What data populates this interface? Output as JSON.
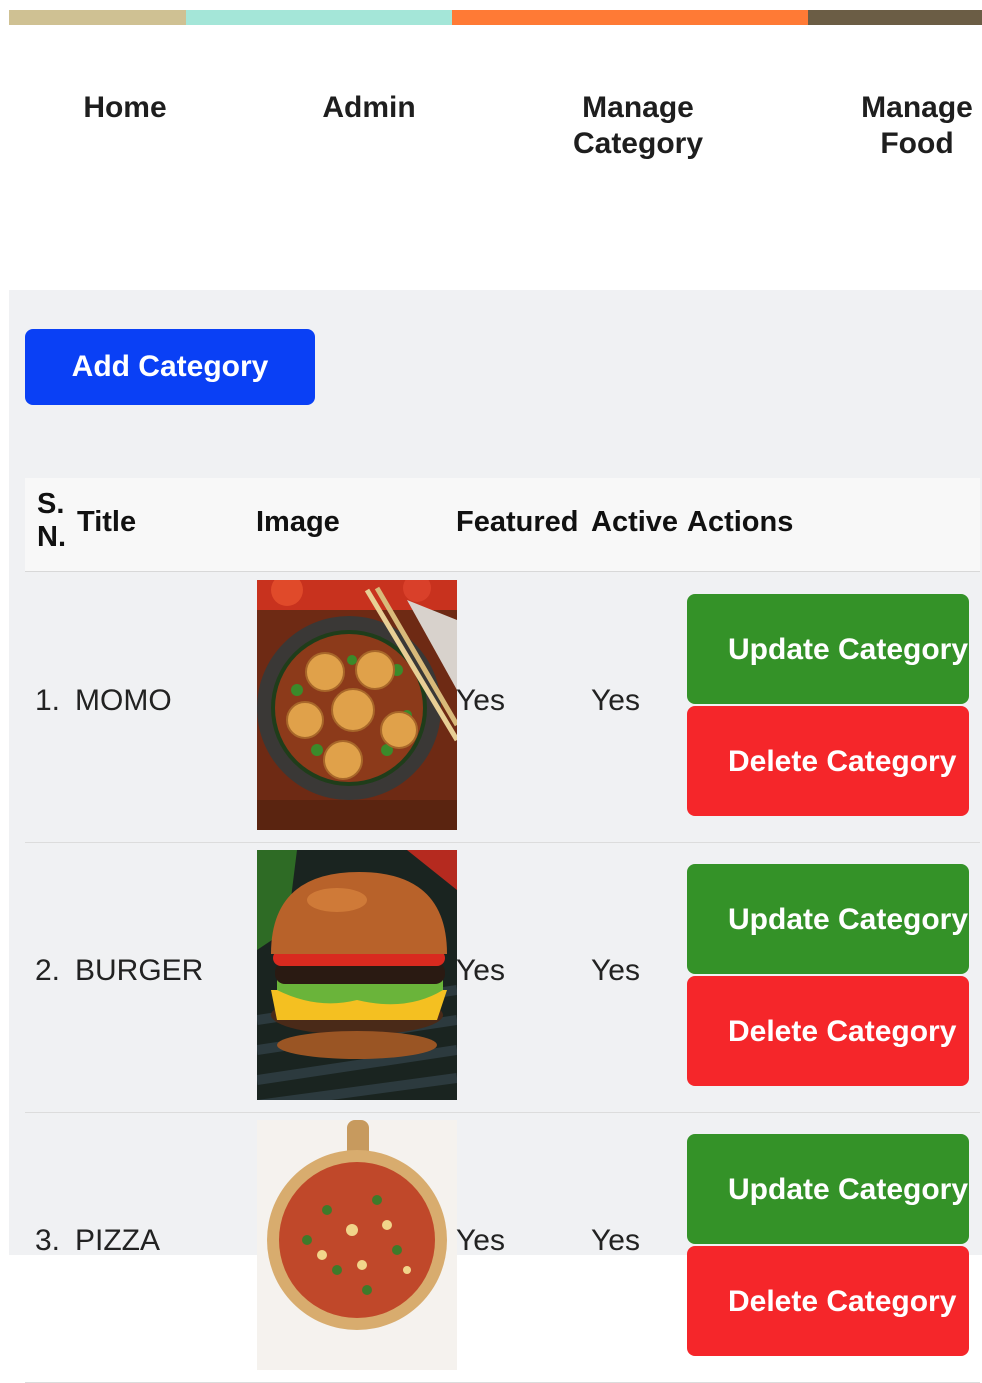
{
  "nav": {
    "home": "Home",
    "admin": "Admin",
    "manage_category": "Manage Category",
    "manage_food": "Manage Food"
  },
  "colors": {
    "stripe": [
      "#cfc193",
      "#a4e6d8",
      "#ff7a35",
      "#6b5d45"
    ],
    "primary_button": "#0a40f5",
    "update_button": "#349228",
    "delete_button": "#f5262a"
  },
  "add_button": "Add Category",
  "table": {
    "headers": {
      "sn": "S. N.",
      "title": "Title",
      "image": "Image",
      "featured": "Featured",
      "active": "Active",
      "actions": "Actions"
    },
    "rows": [
      {
        "sn": "1.",
        "title": "MOMO",
        "image": "momo-image",
        "featured": "Yes",
        "active": "Yes",
        "update_label": "Update Category",
        "delete_label": "Delete Category"
      },
      {
        "sn": "2.",
        "title": "BURGER",
        "image": "burger-image",
        "featured": "Yes",
        "active": "Yes",
        "update_label": "Update Category",
        "delete_label": "Delete Category"
      },
      {
        "sn": "3.",
        "title": "PIZZA",
        "image": "pizza-image",
        "featured": "Yes",
        "active": "Yes",
        "update_label": "Update Category",
        "delete_label": "Delete Category"
      }
    ]
  }
}
